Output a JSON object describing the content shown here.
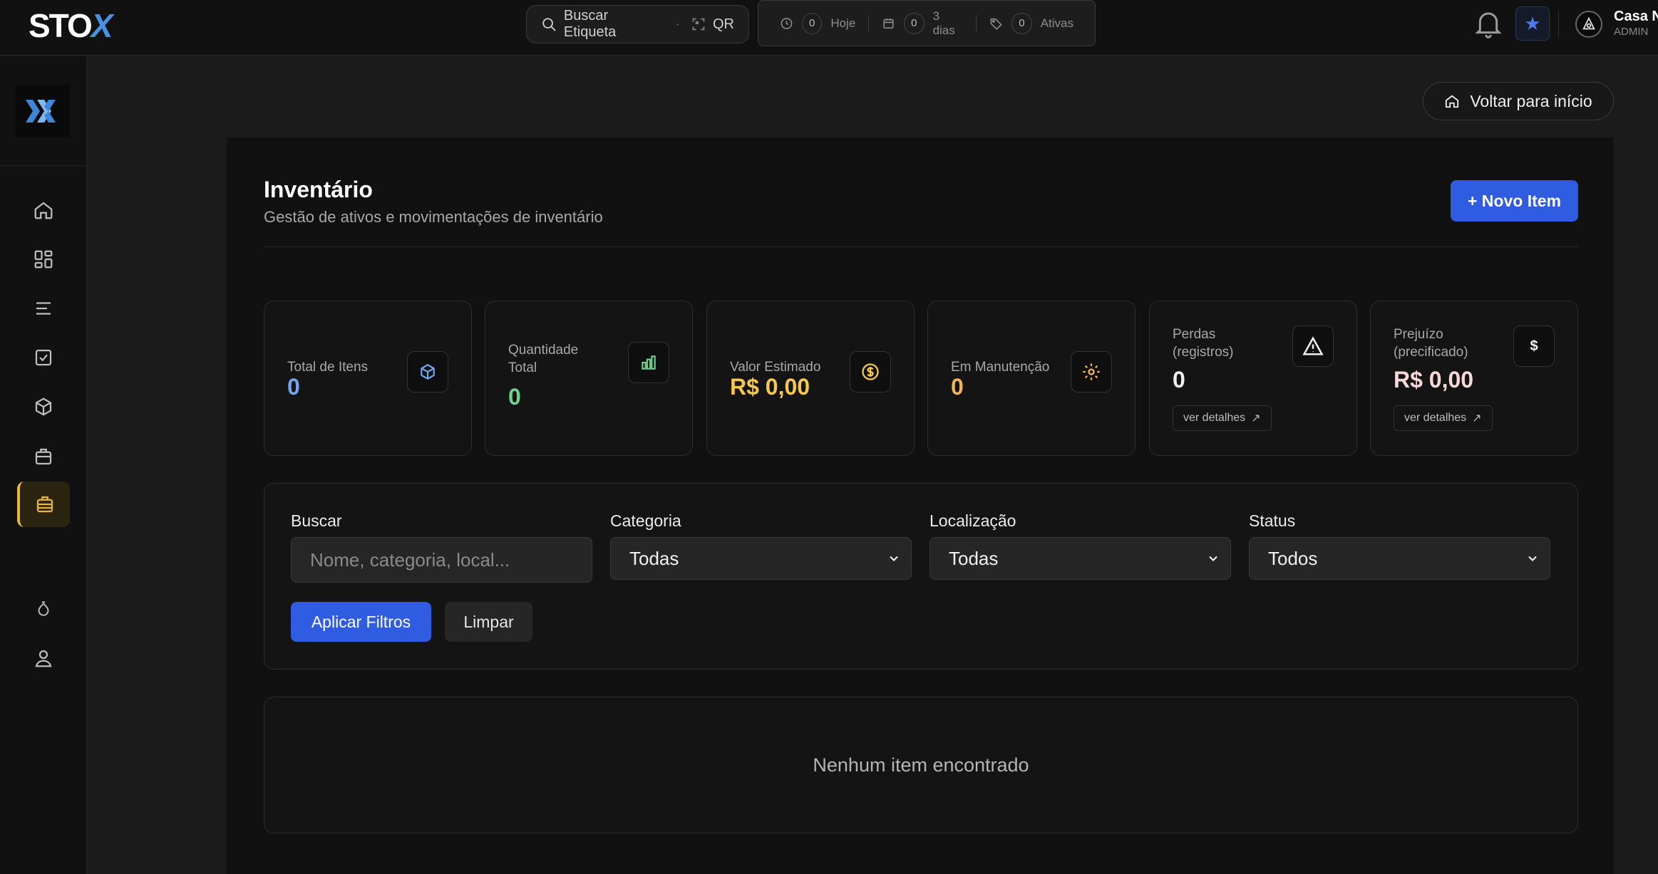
{
  "app": {
    "logo_text_a": "STO",
    "logo_text_b": "X"
  },
  "search": {
    "label": "Buscar Etiqueta",
    "qr_label": "QR"
  },
  "stats_bar": [
    {
      "count": "0",
      "label": "Hoje",
      "icon": "clock-icon"
    },
    {
      "count": "0",
      "label": "3 dias",
      "icon": "calendar-icon"
    },
    {
      "count": "0",
      "label": "Ativas",
      "icon": "tag-icon"
    }
  ],
  "user": {
    "name": "Casa N",
    "role": "ADMIN"
  },
  "colors": {
    "accent": "#2f5ce0",
    "active_nav": "#e8b63a",
    "blue_value": "#6fa8f0",
    "green_value": "#6fd38f",
    "yellow_value": "#f5c84c",
    "orange_value": "#f0b45a"
  },
  "sidebar": {
    "items": [
      {
        "name": "home",
        "icon": "home-icon"
      },
      {
        "name": "dashboard",
        "icon": "dashboard-icon"
      },
      {
        "name": "list",
        "icon": "list-icon"
      },
      {
        "name": "tasks",
        "icon": "checklist-icon"
      },
      {
        "name": "products",
        "icon": "box-icon"
      },
      {
        "name": "assets",
        "icon": "briefcase-icon"
      },
      {
        "name": "inventory",
        "icon": "inventory-icon",
        "active": true
      },
      {
        "name": "drop",
        "icon": "drop-icon"
      },
      {
        "name": "profile",
        "icon": "user-icon"
      }
    ]
  },
  "header": {
    "home_button": "Voltar para início",
    "title": "Inventário",
    "subtitle": "Gestão de ativos e movimentações de inventário",
    "new_item_button": "+ Novo Item"
  },
  "cards": [
    {
      "label": "Total de Itens",
      "value": "0",
      "icon": "cube-icon"
    },
    {
      "label": "Quantidade Total",
      "value": "0",
      "icon": "bar-chart-icon"
    },
    {
      "label": "Valor Estimado",
      "value": "R$ 0,00",
      "icon": "dollar-coin-icon"
    },
    {
      "label": "Em Manutenção",
      "value": "0",
      "icon": "gear-icon"
    },
    {
      "label": "Perdas (registros)",
      "value": "0",
      "icon": "warning-icon",
      "details": "ver detalhes"
    },
    {
      "label": "Prejuízo (precificado)",
      "value": "R$ 0,00",
      "icon": "dollar-icon",
      "icon_text": "$",
      "details": "ver detalhes"
    }
  ],
  "filters": {
    "search_label": "Buscar",
    "search_placeholder": "Nome, categoria, local...",
    "category_label": "Categoria",
    "category_value": "Todas",
    "location_label": "Localização",
    "location_value": "Todas",
    "status_label": "Status",
    "status_value": "Todos",
    "apply_button": "Aplicar Filtros",
    "clear_button": "Limpar"
  },
  "empty_state": "Nenhum item encontrado"
}
